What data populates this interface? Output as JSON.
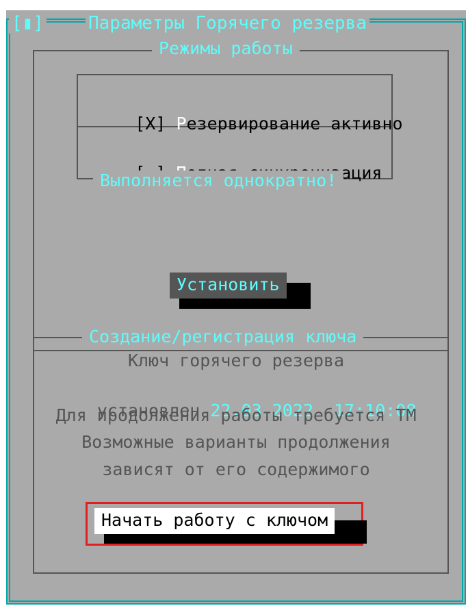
{
  "window": {
    "close_box": "[▮]",
    "title": "Параметры Горячего резерва"
  },
  "modes": {
    "legend": "Режимы работы",
    "reserve": {
      "box": "[X]",
      "hotkey": "Р",
      "label": "езервирование активно",
      "checked": true
    },
    "sync": {
      "box": "[ ]",
      "hotkey": "П",
      "label": "олная синхронизация",
      "checked": false
    },
    "sync_note": "Выполняется однократно!"
  },
  "install_button": {
    "label": "Установить"
  },
  "key": {
    "legend": "Создание/регистрация ключа",
    "line1": "Ключ горячего резерва",
    "installed_label": "установлен",
    "date": "22.03.2022",
    "time": "17:10:08",
    "line3": "Для продолжения работы требуется ТМ",
    "line4": "Возможные варианты продолжения",
    "line5": "зависят от его содержимого"
  },
  "start_button": {
    "label": "Начать работу с ключом"
  },
  "colors": {
    "dialog_bg": "#aaaaaa",
    "accent": "#5ffcfc",
    "border": "#00a8a8",
    "highlight": "#e02020"
  }
}
